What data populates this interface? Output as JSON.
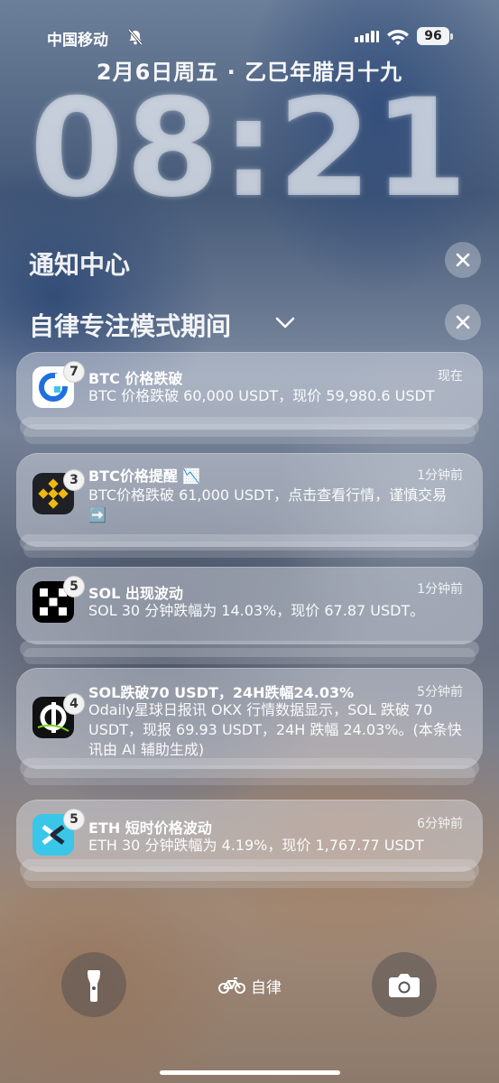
{
  "status_bar": {
    "carrier": "中国移动",
    "battery": "96"
  },
  "lock": {
    "date": "2月6日周五 · 乙巳年腊月十九",
    "time": "08:21"
  },
  "notification_center": {
    "title": "通知中心"
  },
  "focus": {
    "title": "自律专注模式期间",
    "bottom_label": "自律"
  },
  "notifications": [
    {
      "app": "okx",
      "badge": "7",
      "title": "BTC 价格跌破",
      "time": "现在",
      "body": "BTC 价格跌破 60,000 USDT，现价 59,980.6 USDT"
    },
    {
      "app": "binance",
      "badge": "3",
      "title": "BTC价格提醒 📉",
      "time": "1分钟前",
      "body": "BTC价格跌破 61,000 USDT，点击查看行情，谨慎交易 ➡️"
    },
    {
      "app": "okx-black",
      "badge": "5",
      "title": "SOL 出现波动",
      "time": "1分钟前",
      "body": "SOL 30 分钟跌幅为 14.03%，现价 67.87 USDT。"
    },
    {
      "app": "odaily",
      "badge": "4",
      "title": "SOL跌破70 USDT，24H跌幅24.03%",
      "time": "5分钟前",
      "body": "Odaily星球日报讯 OKX 行情数据显示，SOL 跌破 70 USDT，现报 69.93 USDT，24H 跌幅 24.03%。(本条快讯由 AI 辅助生成)"
    },
    {
      "app": "exchange",
      "badge": "5",
      "title": "ETH 短时价格波动",
      "time": "6分钟前",
      "body": "ETH 30 分钟跌幅为 4.19%，现价 1,767.77 USDT"
    }
  ],
  "colors": {
    "okx_blue": "#1f6fe0",
    "binance_yellow": "#f0b90b",
    "exchange_cyan": "#3ac6e8"
  }
}
